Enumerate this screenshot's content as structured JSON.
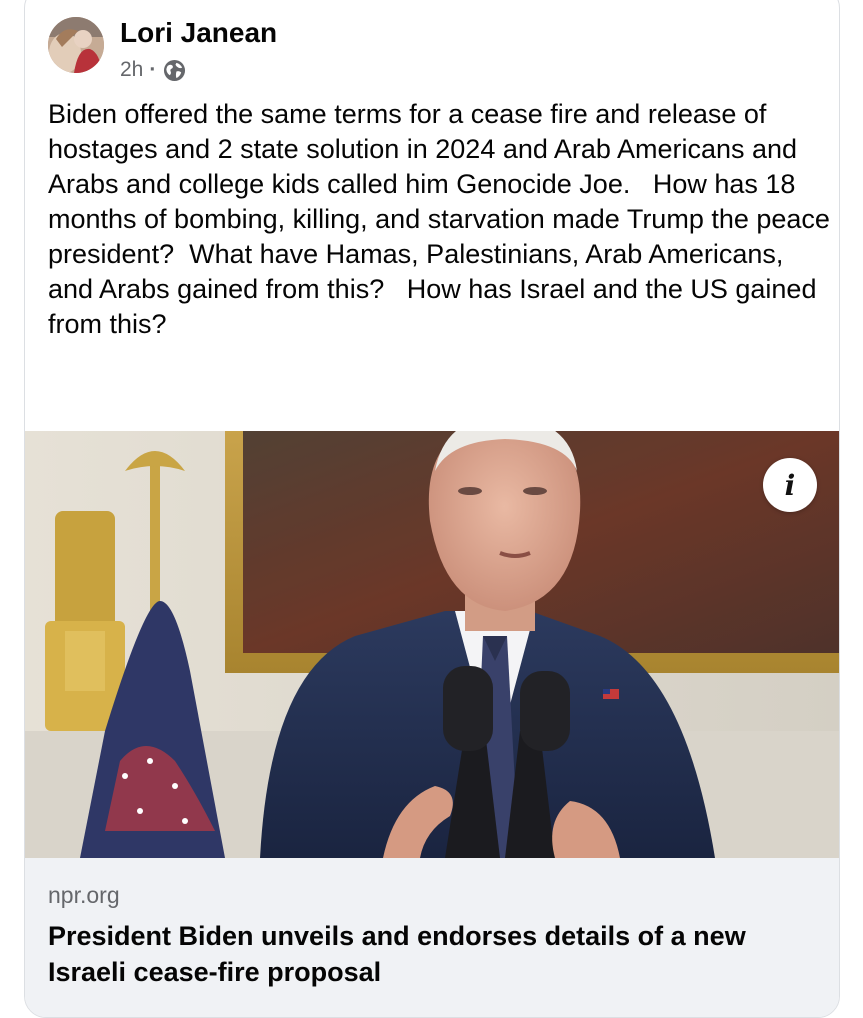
{
  "post": {
    "author": "Lori Janean",
    "time": "2h",
    "separator": "·",
    "privacy_icon": "globe-icon",
    "text": "Biden offered the same terms for a cease fire and release of hostages and 2 state solution in 2024 and Arab Americans and Arabs and college kids called him Genocide Joe.   How has 18 months of bombing, killing, and starvation made Trump the peace president?  What have Hamas, Palestinians, Arab Americans, and Arabs gained from this?   How has Israel and the US gained from this?"
  },
  "link_preview": {
    "info_icon": "info-icon",
    "info_glyph": "i",
    "domain": "npr.org",
    "headline": "President Biden unveils and endorses details of a new Israeli cease-fire proposal"
  },
  "colors": {
    "text_primary": "#050505",
    "text_secondary": "#65676b",
    "footer_background": "#f0f2f5",
    "card_border": "#dcdfe3"
  }
}
